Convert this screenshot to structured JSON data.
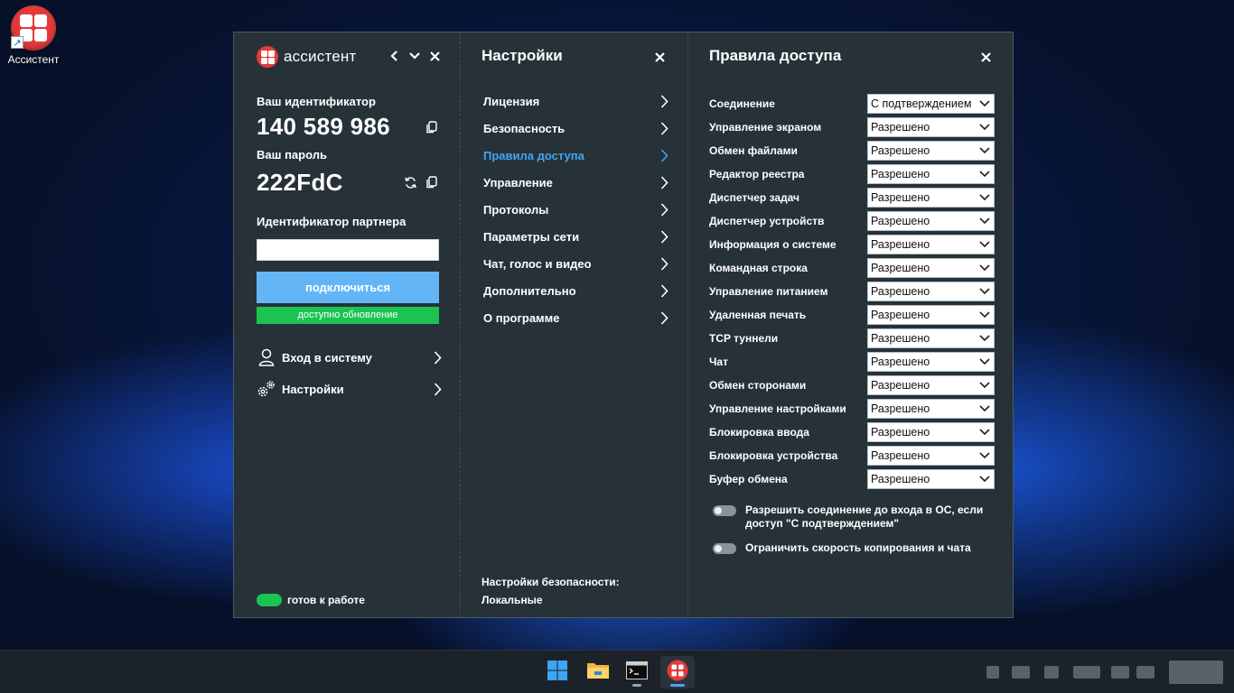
{
  "desktop": {
    "icon_label": "Ассистент"
  },
  "app": {
    "name": "ассистент",
    "id_label": "Ваш идентификатор",
    "id_value": "140 589 986",
    "password_label": "Ваш пароль",
    "password_value": "222FdC",
    "partner_label": "Идентификатор партнера",
    "partner_value": "",
    "connect_label": "подключиться",
    "update_label": "доступно обновление",
    "menu": [
      {
        "label": "Вход в систему",
        "icon": "user-icon"
      },
      {
        "label": "Настройки",
        "icon": "gears-icon"
      }
    ],
    "status_label": "готов к работе"
  },
  "settings": {
    "title": "Настройки",
    "items": [
      {
        "label": "Лицензия"
      },
      {
        "label": "Безопасность"
      },
      {
        "label": "Правила доступа",
        "active": true
      },
      {
        "label": "Управление"
      },
      {
        "label": "Протоколы"
      },
      {
        "label": "Параметры сети"
      },
      {
        "label": "Чат, голос и видео"
      },
      {
        "label": "Дополнительно"
      },
      {
        "label": "О программе"
      }
    ],
    "security_label": "Настройки безопасности:",
    "security_value": "Локальные"
  },
  "access": {
    "title": "Правила доступа",
    "rules": [
      {
        "label": "Соединение",
        "value": "С подтверждением"
      },
      {
        "label": "Управление экраном",
        "value": "Разрешено"
      },
      {
        "label": "Обмен файлами",
        "value": "Разрешено"
      },
      {
        "label": "Редактор реестра",
        "value": "Разрешено"
      },
      {
        "label": "Диспетчер задач",
        "value": "Разрешено"
      },
      {
        "label": "Диспетчер устройств",
        "value": "Разрешено"
      },
      {
        "label": "Информация о системе",
        "value": "Разрешено"
      },
      {
        "label": "Командная строка",
        "value": "Разрешено"
      },
      {
        "label": "Управление питанием",
        "value": "Разрешено"
      },
      {
        "label": "Удаленная печать",
        "value": "Разрешено"
      },
      {
        "label": "TCP туннели",
        "value": "Разрешено"
      },
      {
        "label": "Чат",
        "value": "Разрешено"
      },
      {
        "label": "Обмен сторонами",
        "value": "Разрешено"
      },
      {
        "label": "Управление настройками",
        "value": "Разрешено"
      },
      {
        "label": "Блокировка ввода",
        "value": "Разрешено"
      },
      {
        "label": "Блокировка устройства",
        "value": "Разрешено"
      },
      {
        "label": "Буфер обмена",
        "value": "Разрешено"
      }
    ],
    "options": [
      {
        "label": "Разрешить соединение до входа в ОС, если доступ \"С подтверждением\"",
        "enabled": false
      },
      {
        "label": "Ограничить скорость копирования и чата",
        "enabled": false
      }
    ]
  },
  "colors": {
    "window_bg": "#263238",
    "accent": "#42a5f5",
    "connect_button": "#64b5f6",
    "ready_green": "#1bc452",
    "brand_red": "#e23b3b"
  },
  "taskbar": {
    "apps": [
      {
        "icon": "windows-start-icon"
      },
      {
        "icon": "file-explorer-icon"
      },
      {
        "icon": "terminal-icon"
      },
      {
        "icon": "assistant-app-icon",
        "active": true
      }
    ]
  }
}
